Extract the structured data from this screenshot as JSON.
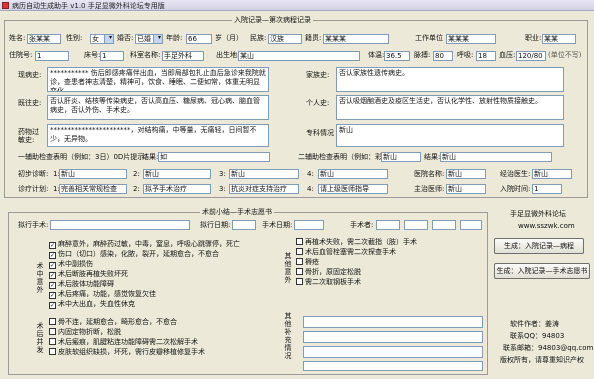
{
  "window": {
    "title": "病历自动生成助手 v1.0 手足显微外科论坛专用版"
  },
  "record_frame": {
    "title": "入院记录—第次病程记录"
  },
  "row1": {
    "name_label": "姓名:",
    "name": "张某某",
    "sex_label": "性别:",
    "sex": "女",
    "marital_label": "婚否:",
    "marital": "已婚",
    "age_label": "年龄:",
    "age": "66",
    "age_unit": "岁（月）",
    "ethnic_label": "民族:",
    "ethnic": "汉族",
    "native_label": "籍贯:",
    "native": "某某某",
    "work_label": "工作单位",
    "work": "某某某",
    "job_label": "职业:",
    "job": "某某"
  },
  "row2": {
    "admno_label": "住院号:",
    "admno": "1",
    "bed_label": "床号:",
    "bed": "1",
    "dept_label": "科室名称:",
    "dept": "手足外科",
    "birth_label": "出生地:",
    "birth": "某山",
    "temp_label": "体温:",
    "temp": "36.5",
    "pulse_label": "脉搏:",
    "pulse": "80",
    "resp_label": "呼吸:",
    "resp": "18",
    "bp_label": "血压:",
    "bp": "120/80",
    "bp_unit": "(单位不写)"
  },
  "history": {
    "present_label": "现病史:",
    "present": "***********  伤后即感疼痛伴出血，当即局部包扎止血后急诊来我院就诊，查患者神志清楚，精神可，饮食、睡眠、二便如常，体重无明显变化。",
    "past_label": "既往史:",
    "past": "否认肝炎、结核等传染病史，否认高血压、糖尿病、冠心病、脑血管病史，否认外伤、手术史。",
    "allergy_label": "药物过敏史:",
    "allergy": "***********************，对结构痛，中等量，无痛轻，日间暂不少，无异物。",
    "family_label": "家族史:",
    "family": "否认家族性遗传病史。",
    "personal_label": "个人史:",
    "personal": "否认吸烟酗酒史及疫区生活史，否认化学性、放射性物质接触史。",
    "specialty_label": "专科情况",
    "specialty": "新山"
  },
  "exam_row": {
    "aux_label": "一辅助检查表明（例如：3日）0D片提示：",
    "aux_result_label": "结果:",
    "aux_result": "如",
    "aux2_label": "二辅助检查表明（例如：彩超）",
    "aux2": "新山",
    "aux2_result_label": "结果:",
    "aux2_result": "新山"
  },
  "diag_row": {
    "initial_label": "初步诊断:",
    "d1_label": "1:",
    "d1": "新山",
    "d2_label": "2:",
    "d2": "新山",
    "d3_label": "3:",
    "d3": "新山",
    "d4_label": "4:",
    "d4": "新山",
    "hospital_label": "医院名称:",
    "hospital": "新山",
    "resident_label": "经治医生:",
    "resident": "新山"
  },
  "plan_row": {
    "plan_label": "诊疗计划:",
    "p1_label": "1:",
    "p1": "完善相关常规检查",
    "p2_label": "2:",
    "p2": "拟予手术治疗",
    "p3_label": "3:",
    "p3": "抗炎对症支持治疗",
    "p4_label": "4:",
    "p4": "请上级医师指导",
    "chief_label": "主治医师:",
    "chief": "新山",
    "adm_time_label": "入院时间:",
    "adm_time": "1"
  },
  "consent_frame": {
    "title": "术前小结—手术志愿书",
    "proposed_label": "拟行手术:",
    "proposed": "",
    "date_label": "拟行日期:",
    "date": "",
    "anesth_label": "手术日期:",
    "anesth": "",
    "surgeon_label": "手术者:",
    "surgeon": "",
    "risk_vlabel": "术中意外",
    "risks": [
      {
        "text": "麻醉意外，麻醉药过敏，中毒，窒息，呼吸心跳骤停，死亡",
        "checked": true
      },
      {
        "text": "伤口（切口）感染，化脓，裂开，延期愈合，不愈合",
        "checked": true
      },
      {
        "text": "术中副损伤",
        "checked": true
      },
      {
        "text": "术后断肢再植失败坏死",
        "checked": true
      },
      {
        "text": "术后肢体功能障碍",
        "checked": true
      },
      {
        "text": "术后疼痛，功能，感觉恢复欠佳",
        "checked": true
      },
      {
        "text": "术中大出血，失血性休克",
        "checked": true
      }
    ],
    "post_vlabel": "术后并发",
    "post": [
      {
        "text": "骨不连，延期愈合，畸形愈合，不愈合",
        "checked": false
      },
      {
        "text": "内固定物折断，松脱",
        "checked": false
      },
      {
        "text": "术后瘢痕，肌腱粘连功能障碍需二次松解手术",
        "checked": false
      },
      {
        "text": "皮肤软组织缺损，坏死，需行皮瓣移植修复手术",
        "checked": false
      }
    ],
    "mid_vlabel": "其他意外",
    "mid": [
      {
        "text": "再植术失败，需二次截指（肢）手术",
        "checked": false
      },
      {
        "text": "术后血管栓塞需二次探查手术",
        "checked": false
      },
      {
        "text": "褥疮",
        "checked": false
      },
      {
        "text": "骨折，原固定松脱",
        "checked": false
      },
      {
        "text": "需二次取钢板手术",
        "checked": false
      }
    ],
    "extra_vlabel": "其他补充情况"
  },
  "sidebar": {
    "forum": "手足显微外科论坛",
    "url": "www.sszwk.com",
    "btn_admission": "生成：入院记录—病程",
    "btn_consent": "生成：入院记录—手术志愿书",
    "author": "软件作者：姜涛",
    "qq": "联系QQ：94803",
    "email": "联系邮箱：94803@qq.com",
    "copyright": "版权所有，请尊重知识产权"
  }
}
